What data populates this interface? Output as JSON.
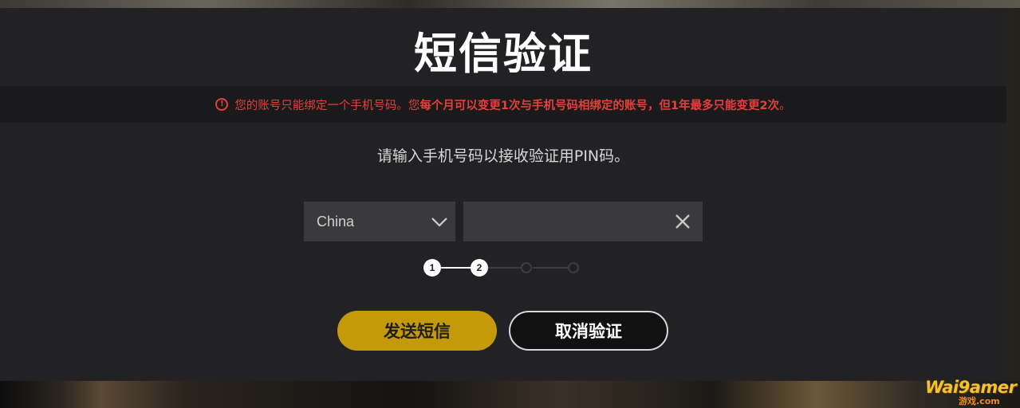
{
  "dialog": {
    "title": "短信验证",
    "warning": {
      "icon": "alert-circle-icon",
      "normal_text": "您的账号只能绑定一个手机号码。您",
      "bold_text": "每个月可以变更1次与手机号码相绑定的账号，但1年最多只能变更2次",
      "end_text": "。",
      "color": "#e2403a"
    },
    "instruction": "请输入手机号码以接收验证用PIN码。",
    "country_select": {
      "value": "China",
      "icon": "chevron-down-icon"
    },
    "phone_input": {
      "value": "",
      "placeholder": "",
      "clear_icon": "close-icon"
    },
    "stepper": {
      "steps": [
        "1",
        "2",
        "",
        ""
      ],
      "current": 2,
      "total": 4
    },
    "buttons": {
      "send_label": "发送短信",
      "cancel_label": "取消验证",
      "send_color": "#c49a0b"
    }
  },
  "watermark": {
    "text": "Wai9amer",
    "sub_text": "游戏.com"
  }
}
